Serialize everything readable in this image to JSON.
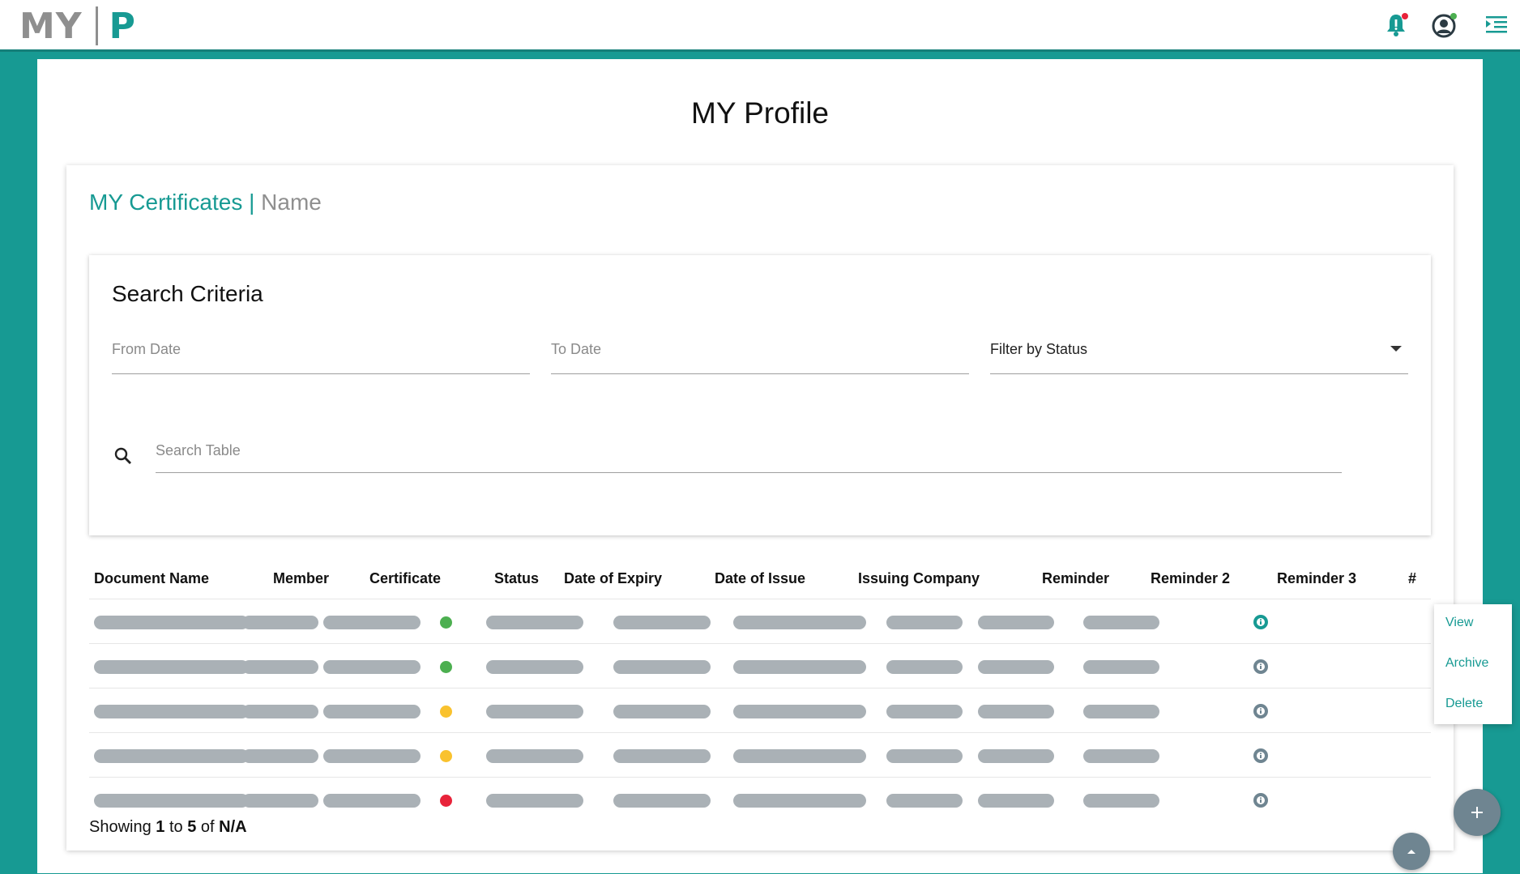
{
  "header": {
    "logo_left": "MY",
    "logo_right": "P",
    "icons": [
      "bell-icon",
      "account-icon",
      "menu-toggle-icon"
    ]
  },
  "page": {
    "title": "MY Profile"
  },
  "card": {
    "title": "MY Certificates |",
    "title_name": "Name"
  },
  "search": {
    "title": "Search Criteria",
    "from_date_placeholder": "From Date",
    "to_date_placeholder": "To Date",
    "status_filter_value": "Filter by Status",
    "table_search_placeholder": "Search Table"
  },
  "table": {
    "columns": [
      "Document Name",
      "Member",
      "Certificate",
      "Status",
      "Date of Expiry",
      "Date of Issue",
      "Issuing Company",
      "Reminder",
      "Reminder 2",
      "Reminder 3",
      "#"
    ],
    "rows": [
      {
        "status": "green"
      },
      {
        "status": "green"
      },
      {
        "status": "yellow"
      },
      {
        "status": "yellow"
      },
      {
        "status": "red"
      }
    ],
    "status_colors": {
      "green": "#4caf50",
      "yellow": "#f9c22e",
      "red": "#e8233a"
    }
  },
  "pagination": {
    "prefix": "Showing",
    "from": "1",
    "to_word": "to",
    "to": "5",
    "of_word": "of",
    "total": "N/A"
  },
  "context_menu": {
    "items": [
      "View",
      "Archive",
      "Delete"
    ]
  },
  "colors": {
    "accent": "#179a93",
    "placeholder_bar": "#aab1b6",
    "fab": "#6f8591"
  }
}
